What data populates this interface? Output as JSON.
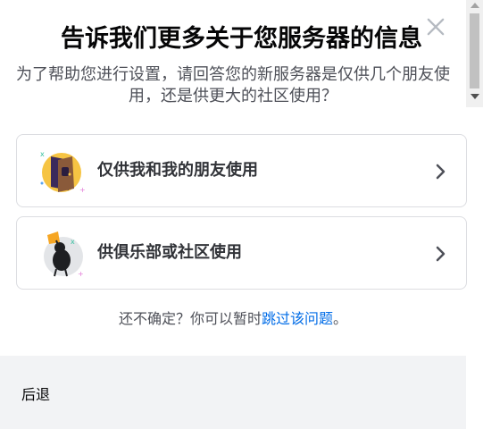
{
  "modal": {
    "title": "告诉我们更多关于您服务器的信息",
    "subtitle": "为了帮助您进行设置，请回答您的新服务器是仅供几个朋友使用，还是供更大的社区使用？",
    "close_icon": "close-icon"
  },
  "options": [
    {
      "label": "仅供我和我的朋友使用",
      "icon": "friends-door-illustration",
      "chevron": "chevron-right-icon"
    },
    {
      "label": "供俱乐部或社区使用",
      "icon": "community-flag-illustration",
      "chevron": "chevron-right-icon"
    }
  ],
  "hint": {
    "prefix": "还不确定？你可以暂时",
    "link": "跳过该问题",
    "suffix": "。"
  },
  "footer": {
    "back_label": "后退"
  },
  "colors": {
    "title": "#060607",
    "subtitle": "#4e5058",
    "link": "#006ce7",
    "footer_bg": "#f2f3f5",
    "option_border": "#dcdde1"
  }
}
